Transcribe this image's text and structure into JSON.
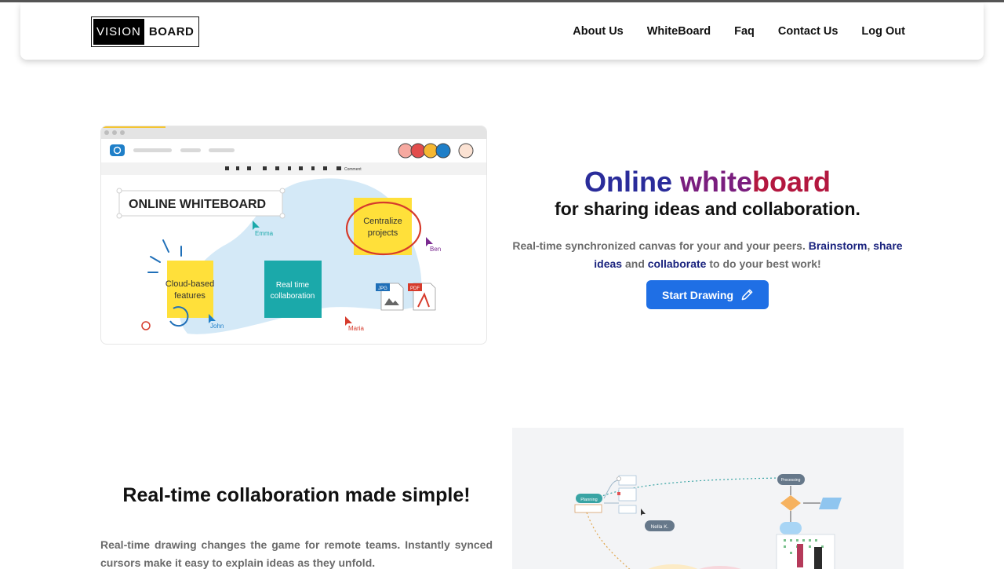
{
  "brand": {
    "logo_left": "VISION",
    "logo_right": "BOARD"
  },
  "nav": {
    "items": [
      {
        "label": "About Us"
      },
      {
        "label": "WhiteBoard"
      },
      {
        "label": "Faq"
      },
      {
        "label": "Contact Us"
      },
      {
        "label": "Log Out"
      }
    ]
  },
  "hero": {
    "title_words": [
      "Online",
      "white",
      "board"
    ],
    "subtitle": "for sharing ideas and collaboration.",
    "desc_parts": [
      "Real-time synchronized canvas for your and your peers. ",
      "Brainstorm",
      ", ",
      "share ideas",
      " and ",
      "collaborate",
      " to do your best work!"
    ],
    "cta_label": "Start Drawing",
    "cta_icon": "pencil-icon",
    "cta_color": "#1f6fe5"
  },
  "illustration": {
    "toolbar_comment": "Comment",
    "heading": "ONLINE WHITEBOARD",
    "notes": [
      {
        "text1": "Centralize",
        "text2": "projects",
        "color": "#ffe03a"
      },
      {
        "text1": "Cloud-based",
        "text2": "features",
        "color": "#ffe03a"
      },
      {
        "text1": "Real time",
        "text2": "collaboration",
        "color": "#1ba9aa"
      }
    ],
    "cursors": [
      "Emma",
      "Ben",
      "John",
      "Maria"
    ],
    "files": [
      "JPG",
      "PDF"
    ]
  },
  "section2": {
    "title": "Real-time collaboration made simple!",
    "desc": "Real-time drawing changes the game for remote teams. Instantly synced cursors make it easy to explain ideas as they unfold.",
    "diagram": {
      "node_planning": "Planning",
      "node_processing": "Processing",
      "user_tag": "Nella K."
    }
  }
}
